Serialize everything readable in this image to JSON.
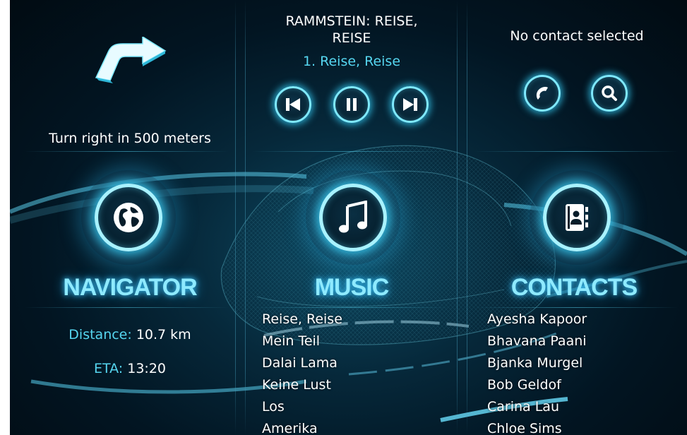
{
  "navigator": {
    "instruction": "Turn right in 500 meters",
    "title": "NAVIGATOR",
    "distance_label": "Distance:",
    "distance_value": "10.7 km",
    "eta_label": "ETA:",
    "eta_value": "13:20"
  },
  "music": {
    "artist_album_line1": "RAMMSTEIN: REISE,",
    "artist_album_line2": "REISE",
    "now_playing": "1. Reise, Reise",
    "title": "MUSIC",
    "tracks": [
      "Reise, Reise",
      "Mein Teil",
      "Dalai Lama",
      "Keine Lust",
      "Los",
      "Amerika"
    ]
  },
  "contacts": {
    "status": "No contact selected",
    "title": "CONTACTS",
    "people": [
      "Ayesha Kapoor",
      "Bhavana Paani",
      "Bjanka Murgel",
      "Bob Geldof",
      "Carina Lau",
      "Chloe Sims"
    ]
  },
  "icons": {
    "turn": "turn-right-arrow-icon",
    "globe": "globe-icon",
    "music": "music-note-icon",
    "contacts": "address-book-icon",
    "prev": "skip-previous-icon",
    "pause": "pause-icon",
    "next": "skip-next-icon",
    "call": "phone-icon",
    "search": "search-icon"
  },
  "colors": {
    "accent": "#56d6f0",
    "glow": "#7fe9ff",
    "background": "#021522"
  }
}
